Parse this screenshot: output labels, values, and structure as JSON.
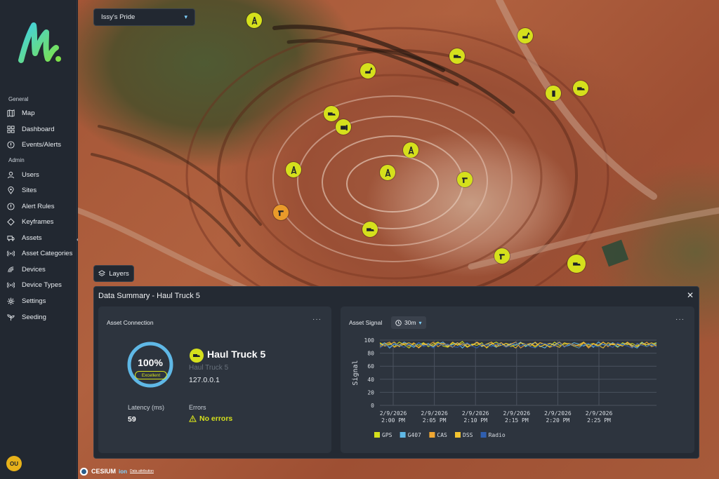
{
  "sidebar": {
    "sections": {
      "general": "General",
      "admin": "Admin"
    },
    "general_items": [
      {
        "label": "Map",
        "icon": "map-icon"
      },
      {
        "label": "Dashboard",
        "icon": "dashboard-icon"
      },
      {
        "label": "Events/Alerts",
        "icon": "alert-circle-icon"
      }
    ],
    "admin_items": [
      {
        "label": "Users",
        "icon": "user-icon"
      },
      {
        "label": "Sites",
        "icon": "location-pin-icon"
      },
      {
        "label": "Alert Rules",
        "icon": "alert-circle-icon"
      },
      {
        "label": "Keyframes",
        "icon": "keyframe-icon"
      },
      {
        "label": "Assets",
        "icon": "truck-icon"
      },
      {
        "label": "Asset Categories",
        "icon": "signal-icon"
      },
      {
        "label": "Devices",
        "icon": "device-icon"
      },
      {
        "label": "Device Types",
        "icon": "signal-icon"
      },
      {
        "label": "Settings",
        "icon": "gear-icon"
      },
      {
        "label": "Seeding",
        "icon": "seedling-icon"
      }
    ],
    "user_initials": "OU",
    "collapse_glyph": "«"
  },
  "map": {
    "site_select": "Issy's Pride",
    "layers_label": "Layers",
    "attribution": {
      "brand": "CESIUM",
      "ion": "ion",
      "link": "Data attribution"
    }
  },
  "panel": {
    "title": "Data Summary - Haul Truck 5",
    "close_glyph": "✕",
    "connection": {
      "title": "Asset Connection",
      "more": "···",
      "percent": "100%",
      "percent_value": 1.0,
      "quality": "Excellent",
      "asset_name": "Haul Truck 5",
      "asset_subtitle": "Haul Truck 5",
      "ip": "127.0.0.1",
      "latency_label": "Latency (ms)",
      "latency_value": "59",
      "errors_label": "Errors",
      "errors_value": "No errors"
    },
    "signal": {
      "title": "Asset Signal",
      "range": "30m",
      "more": "···"
    }
  },
  "colors": {
    "accent": "#d5e01c",
    "gauge": "#5fb8e6",
    "warning_marker": "#e99a2a"
  },
  "chart_data": {
    "type": "line",
    "ylabel": "Signal",
    "ylim": [
      0,
      100
    ],
    "yticks": [
      0,
      20,
      40,
      60,
      80,
      100
    ],
    "x_ticks": [
      [
        "2/9/2026",
        "2:00 PM"
      ],
      [
        "2/9/2026",
        "2:05 PM"
      ],
      [
        "2/9/2026",
        "2:10 PM"
      ],
      [
        "2/9/2026",
        "2:15 PM"
      ],
      [
        "2/9/2026",
        "2:20 PM"
      ],
      [
        "2/9/2026",
        "2:25 PM"
      ]
    ],
    "series": [
      {
        "name": "GPS",
        "color": "#d5e01c",
        "values": [
          96,
          92,
          95,
          90,
          97,
          93,
          88,
          95,
          92,
          96,
          90,
          94,
          97,
          91,
          89,
          95,
          93,
          98,
          90,
          94,
          92,
          96,
          88,
          94,
          97,
          92,
          95,
          90,
          93,
          96,
          91,
          95,
          89,
          96,
          93,
          90,
          97,
          92,
          94,
          95,
          91,
          88,
          96,
          93,
          95,
          90,
          97,
          92,
          94,
          89,
          96,
          93,
          95,
          91,
          97,
          90,
          94,
          96
        ]
      },
      {
        "name": "G407",
        "color": "#5fb8e6",
        "values": [
          92,
          96,
          88,
          94,
          91,
          97,
          93,
          89,
          96,
          92,
          95,
          90,
          94,
          97,
          91,
          93,
          96,
          88,
          95,
          92,
          97,
          90,
          94,
          93,
          89,
          96,
          91,
          95,
          92,
          97,
          90,
          94,
          96,
          91,
          88,
          95,
          93,
          97,
          90,
          92,
          96,
          94,
          91,
          95,
          89,
          97,
          93,
          92,
          96,
          90,
          94,
          95,
          91,
          88,
          96,
          93,
          92,
          95
        ]
      },
      {
        "name": "CAS",
        "color": "#f0a732",
        "values": [
          90,
          94,
          97,
          89,
          93,
          95,
          91,
          96,
          88,
          94,
          92,
          97,
          90,
          95,
          93,
          89,
          96,
          92,
          94,
          91,
          97,
          93,
          89,
          95,
          92,
          96,
          90,
          94,
          97,
          88,
          93,
          95,
          91,
          96,
          94,
          89,
          92,
          97,
          90,
          95,
          93,
          91,
          96,
          88,
          94,
          92,
          97,
          90,
          95,
          93,
          91,
          96,
          89,
          94,
          92,
          97,
          90,
          93
        ]
      },
      {
        "name": "DSS",
        "color": "#f4c430",
        "values": [
          95,
          91,
          93,
          97,
          90,
          94,
          96,
          92,
          89,
          95,
          93,
          91,
          96,
          94,
          90,
          97,
          92,
          95,
          89,
          93,
          96,
          91,
          94,
          97,
          90,
          92,
          95,
          93,
          88,
          96,
          94,
          91,
          97,
          90,
          93,
          95,
          92,
          89,
          96,
          94,
          91,
          93,
          97,
          90,
          95,
          92,
          88,
          96,
          93,
          94,
          91,
          97,
          92,
          90,
          95,
          93,
          96,
          91
        ]
      },
      {
        "name": "Radio",
        "color": "#2f5fb0",
        "values": [
          88,
          93,
          90,
          95,
          92,
          89,
          94,
          91,
          96,
          90,
          93,
          88,
          95,
          92,
          94,
          90,
          89,
          93,
          96,
          91,
          88,
          94,
          92,
          90,
          95,
          93,
          89,
          92,
          96,
          91,
          94,
          90,
          88,
          93,
          95,
          92,
          90,
          96,
          89,
          94,
          92,
          88,
          93,
          95,
          91,
          90,
          94,
          92,
          89,
          96,
          93,
          91,
          88,
          95,
          92,
          90,
          94,
          89
        ]
      }
    ]
  }
}
